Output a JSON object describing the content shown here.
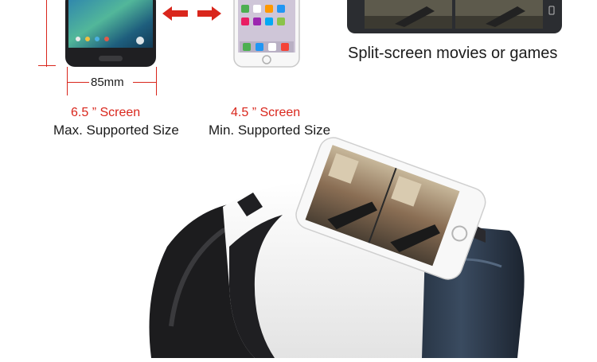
{
  "size_block_large": {
    "measure_label": "85mm",
    "screen_label": "6.5 ” Screen",
    "caption": "Max. Supported Size"
  },
  "size_block_small": {
    "screen_label": "4.5 ” Screen",
    "caption": "Min. Supported Size"
  },
  "feature_caption": "Split-screen movies or games",
  "colors": {
    "accent_red": "#d9261c",
    "text_dark": "#1b1b1b",
    "headset_white": "#f4f4f4",
    "headset_black": "#1e1f22",
    "headset_blue": "#2a3645"
  },
  "icons": [
    "swap-arrows-icon",
    "android-phone-icon",
    "iphone-icon",
    "vr-headset-icon"
  ]
}
